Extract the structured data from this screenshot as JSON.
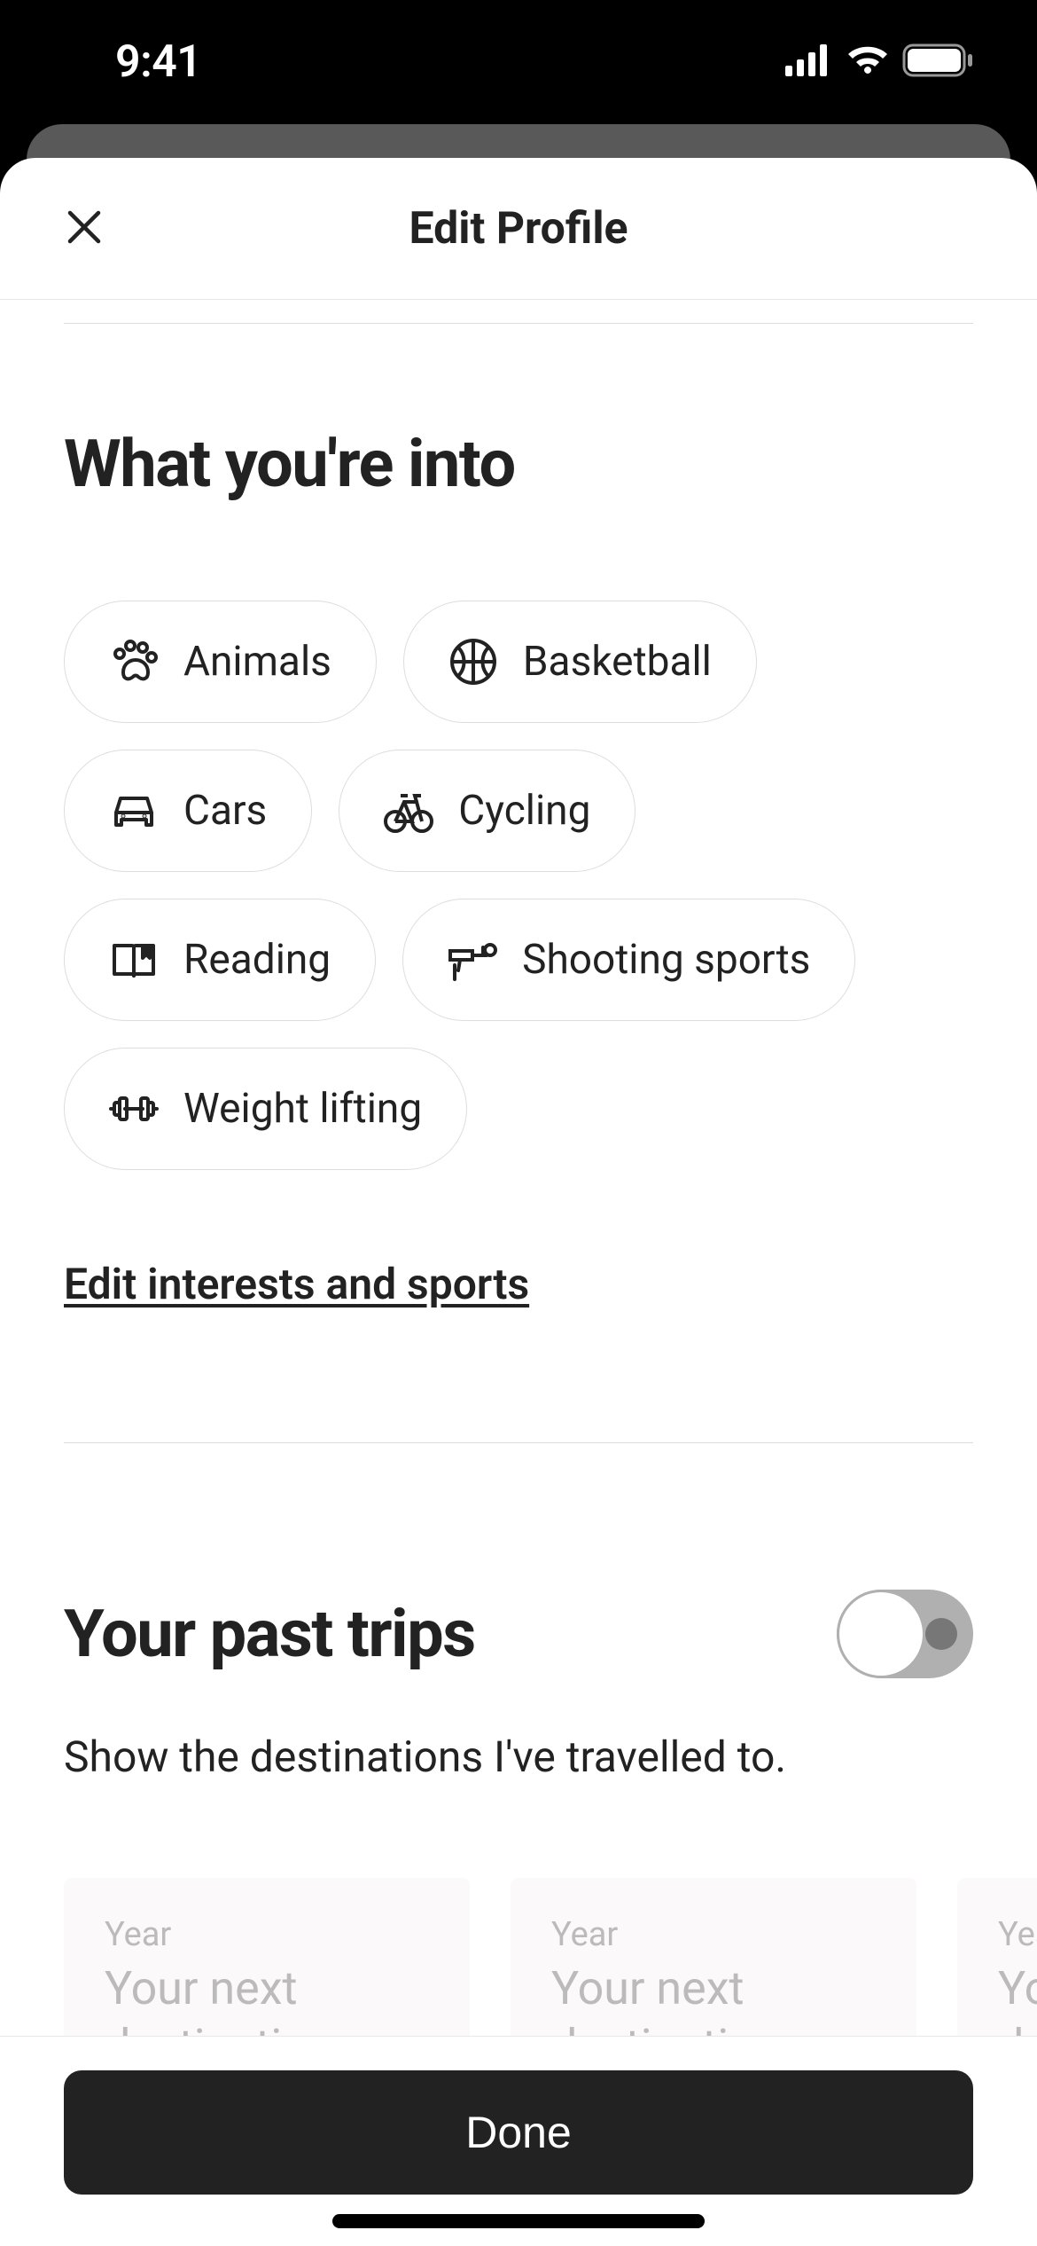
{
  "status_bar": {
    "time": "9:41"
  },
  "header": {
    "title": "Edit Profile"
  },
  "interests": {
    "title": "What you're into",
    "chips": [
      {
        "icon": "animals",
        "label": "Animals"
      },
      {
        "icon": "basketball",
        "label": "Basketball"
      },
      {
        "icon": "cars",
        "label": "Cars"
      },
      {
        "icon": "cycling",
        "label": "Cycling"
      },
      {
        "icon": "reading",
        "label": "Reading"
      },
      {
        "icon": "shooting",
        "label": "Shooting sports"
      },
      {
        "icon": "weightlifting",
        "label": "Weight lifting"
      }
    ],
    "edit_link": "Edit interests and sports"
  },
  "past_trips": {
    "title": "Your past trips",
    "subtitle": "Show the destinations I've travelled to.",
    "toggle_on": false,
    "cards": [
      {
        "year_label": "Year",
        "dest_placeholder": "Your next destination"
      },
      {
        "year_label": "Year",
        "dest_placeholder": "Your next destination"
      },
      {
        "year_label": "Year",
        "dest_placeholder": "Your next destination"
      }
    ]
  },
  "footer": {
    "done_label": "Done"
  }
}
